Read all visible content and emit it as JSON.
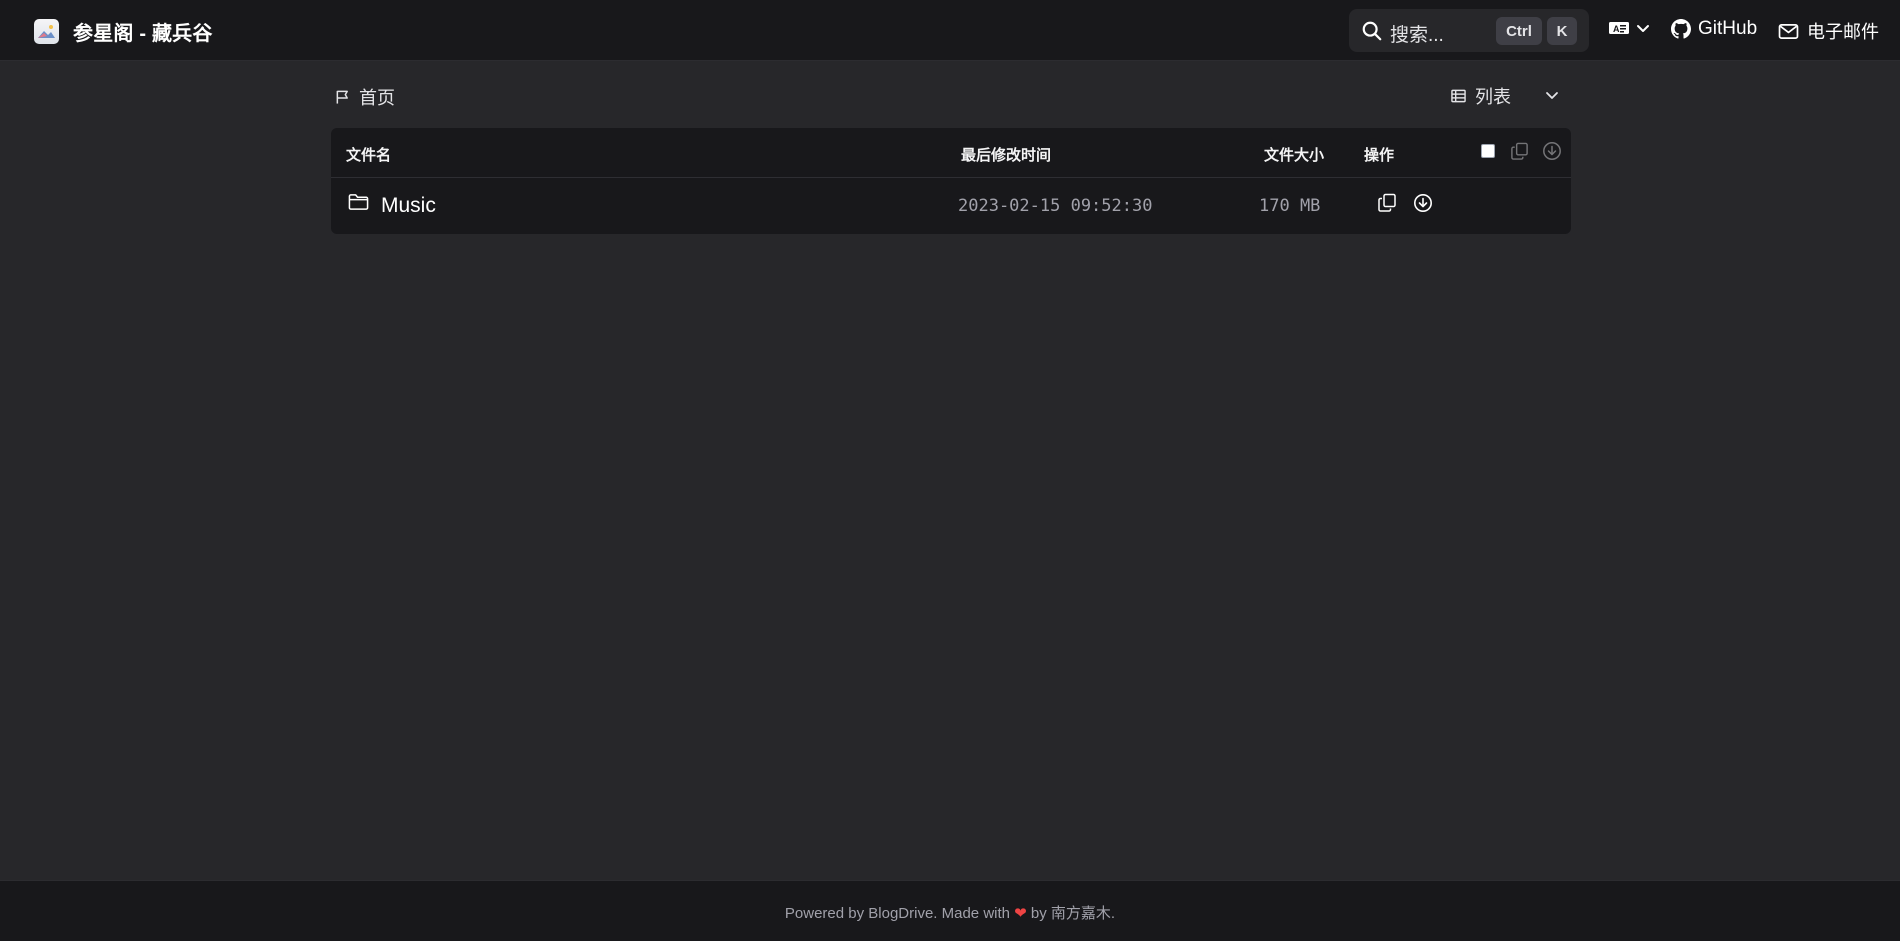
{
  "header": {
    "logo_icon": "image-logo-icon",
    "title": "参星阁 - 藏兵谷",
    "search": {
      "placeholder": "搜索...",
      "shortcut_ctrl": "Ctrl",
      "shortcut_key": "K"
    },
    "lang_icon": "language-icon",
    "github_label": "GitHub",
    "email_label": "电子邮件"
  },
  "breadcrumb": {
    "icon": "flag-icon",
    "label": "首页"
  },
  "view_switch": {
    "icon": "list-view-icon",
    "label": "列表"
  },
  "table": {
    "columns": [
      "文件名",
      "最后修改时间",
      "文件大小",
      "操作"
    ],
    "rows": [
      {
        "icon": "folder-icon",
        "name": "Music",
        "modified": "2023-02-15 09:52:30",
        "size": "170 MB"
      }
    ],
    "select_all_checked": false
  },
  "footer": {
    "prefix": "Powered by BlogDrive. Made with ",
    "heart": "❤",
    "suffix": " by 南方嘉木."
  },
  "colors": {
    "background": "#27272a",
    "surface": "#18181b",
    "text_primary": "#ffffff",
    "text_muted": "#a1a1aa",
    "heart": "#ef4444"
  }
}
